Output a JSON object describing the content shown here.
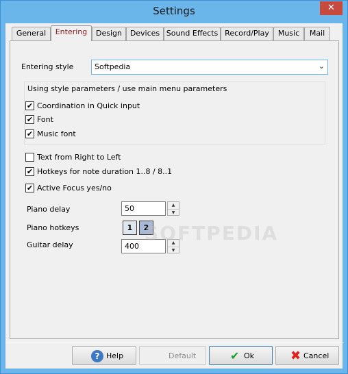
{
  "window": {
    "title": "Settings",
    "close_glyph": "✕"
  },
  "tabs": [
    {
      "label": "General"
    },
    {
      "label": "Entering"
    },
    {
      "label": "Design"
    },
    {
      "label": "Devices"
    },
    {
      "label": "Sound Effects"
    },
    {
      "label": "Record/Play"
    },
    {
      "label": "Music"
    },
    {
      "label": "Mail"
    }
  ],
  "active_tab": "Entering",
  "entering": {
    "style_label": "Entering style",
    "style_value": "Softpedia",
    "group_title": "Using style parameters / use main menu parameters",
    "group_items": [
      {
        "label": "Coordination in Quick input",
        "checked": true
      },
      {
        "label": "Font",
        "checked": true
      },
      {
        "label": "Music font",
        "checked": true
      }
    ],
    "options": [
      {
        "label": "Text from Right to Left",
        "checked": false
      },
      {
        "label": "Hotkeys for note duration 1..8 / 8..1",
        "checked": true
      },
      {
        "label": "Active Focus yes/no",
        "checked": true
      }
    ],
    "piano_delay_label": "Piano delay",
    "piano_delay_value": "50",
    "piano_hotkeys_label": "Piano hotkeys",
    "piano_hotkeys": [
      "1",
      "2"
    ],
    "guitar_delay_label": "Guitar delay",
    "guitar_delay_value": "400",
    "check_glyph": "✔"
  },
  "watermark": "SOFTPEDIA",
  "buttons": {
    "help": "Help",
    "default": "Default",
    "ok": "Ok",
    "cancel": "Cancel"
  },
  "icons": {
    "help": "?",
    "ok": "✔",
    "cancel": "✖",
    "up": "▲",
    "down": "▼",
    "chevron": "⌄"
  },
  "colors": {
    "titlebar": "#6ab5ea",
    "active_tab_text": "#8b1a1a",
    "close_button": "#c74a3f"
  }
}
